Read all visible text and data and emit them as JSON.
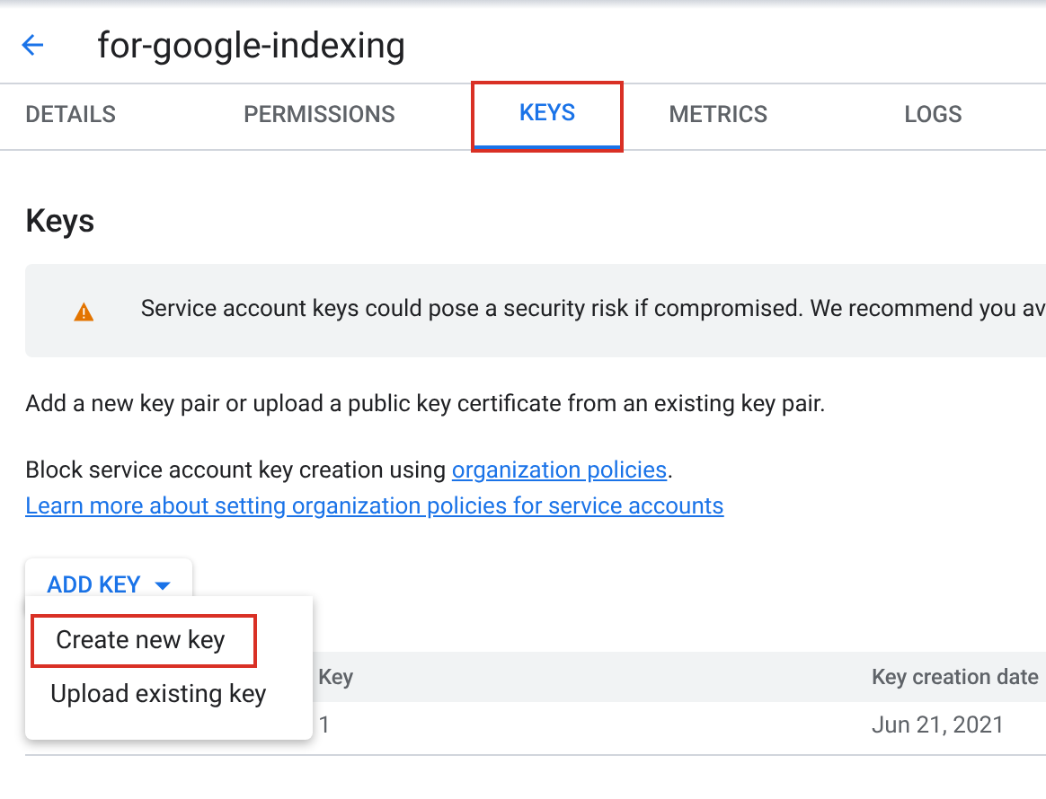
{
  "header": {
    "title": "for-google-indexing"
  },
  "tabs": [
    {
      "label": "DETAILS",
      "selected": false,
      "highlighted": false
    },
    {
      "label": "PERMISSIONS",
      "selected": false,
      "highlighted": false
    },
    {
      "label": "KEYS",
      "selected": true,
      "highlighted": true
    },
    {
      "label": "METRICS",
      "selected": false,
      "highlighted": false
    },
    {
      "label": "LOGS",
      "selected": false,
      "highlighted": false
    }
  ],
  "heading": "Keys",
  "warning": "Service account keys could pose a security risk if compromised. We recommend you av",
  "description": "Add a new key pair or upload a public key certificate from an existing key pair.",
  "policy_text": "Block service account key creation using",
  "policy_link": "organization policies",
  "policy_end": ".",
  "learn_more_link": "Learn more about setting organization policies for service accounts",
  "add_key_button": "ADD KEY",
  "menu": [
    {
      "label": "Create new key",
      "highlighted": true
    },
    {
      "label": "Upload existing key",
      "highlighted": false
    }
  ],
  "table": {
    "columns": [
      "Key",
      "Key creation date"
    ],
    "rows": [
      [
        "1",
        "Jun 21, 2021"
      ]
    ]
  }
}
